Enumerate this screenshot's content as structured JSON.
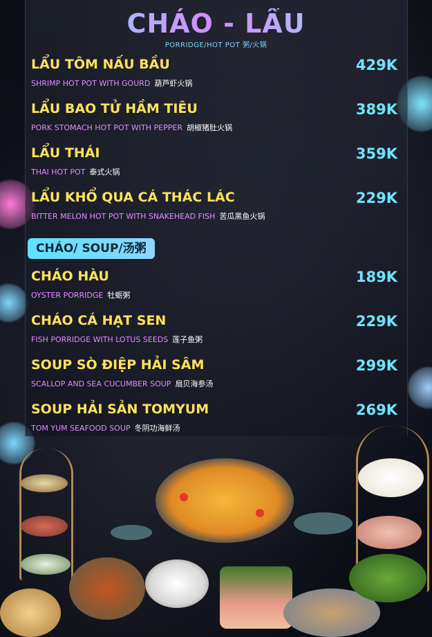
{
  "header": {
    "title": "CHÁO - LẨU",
    "subtitle": "PORRIDGE/HOT POT 粥/火锅"
  },
  "hotpot": [
    {
      "name": "LẨU TÔM NẤU  BẦU",
      "price": "429K",
      "desc_en": "SHRIMP HOT POT WITH GOURD",
      "desc_zh": "葫芦虾火锅"
    },
    {
      "name": "LẨU BAO TỬ HẦM TIÊU",
      "price": "389K",
      "desc_en": "PORK STOMACH HOT POT WITH PEPPER",
      "desc_zh": "胡椒猪肚火锅"
    },
    {
      "name": "LẨU THÁI",
      "price": "359K",
      "desc_en": "THAI HOT POT",
      "desc_zh": "泰式火锅"
    },
    {
      "name": "LẨU  KHỔ QUA CÁ THÁC LÁC",
      "price": "229K",
      "desc_en": "BITTER MELON HOT POT WITH SNAKEHEAD FISH",
      "desc_zh": "苦瓜黑鱼火锅"
    }
  ],
  "section": {
    "label": "CHÁO/ SOUP/汤粥"
  },
  "soup": [
    {
      "name": "CHÁO HÀU",
      "price": "189K",
      "desc_en": "OYSTER PORRIDGE",
      "desc_zh": "牡蛎粥"
    },
    {
      "name": "CHÁO CÁ  HẠT SEN",
      "price": "229K",
      "desc_en": "FISH PORRIDGE WITH LOTUS SEEDS",
      "desc_zh": "莲子鱼粥"
    },
    {
      "name": "SOUP SÒ ĐIỆP HẢI SÂM",
      "price": "299K",
      "desc_en": "SCALLOP AND SEA CUCUMBER SOUP",
      "desc_zh": "扇贝海参汤"
    },
    {
      "name": "SOUP HẢI SẢN TOMYUM",
      "price": "269K",
      "desc_en": "TOM YUM SEAFOOD SOUP",
      "desc_zh": "冬阴功海鲜汤"
    }
  ],
  "colors": {
    "name": "#ffe25a",
    "price": "#6ee5ff",
    "desc": "#e38cff",
    "section_bg": "#5fe1ff"
  }
}
